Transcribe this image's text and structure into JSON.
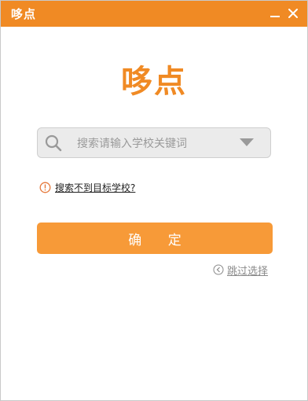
{
  "window": {
    "title": "哆点"
  },
  "brand": {
    "logo_text": "哆点",
    "color": "#f08a24"
  },
  "search": {
    "placeholder": "搜索请输入学校关键词",
    "value": ""
  },
  "hint": {
    "link_text": "搜索不到目标学校?"
  },
  "confirm": {
    "label": "确 定",
    "color": "#f79a38"
  },
  "skip": {
    "label": "跳过选择"
  },
  "icons": {
    "minimize": "minimize-icon",
    "close": "close-icon",
    "search": "search-icon",
    "dropdown": "triangle-down-icon",
    "warning": "exclamation-circle-icon",
    "back": "arrow-left-circle-icon"
  }
}
